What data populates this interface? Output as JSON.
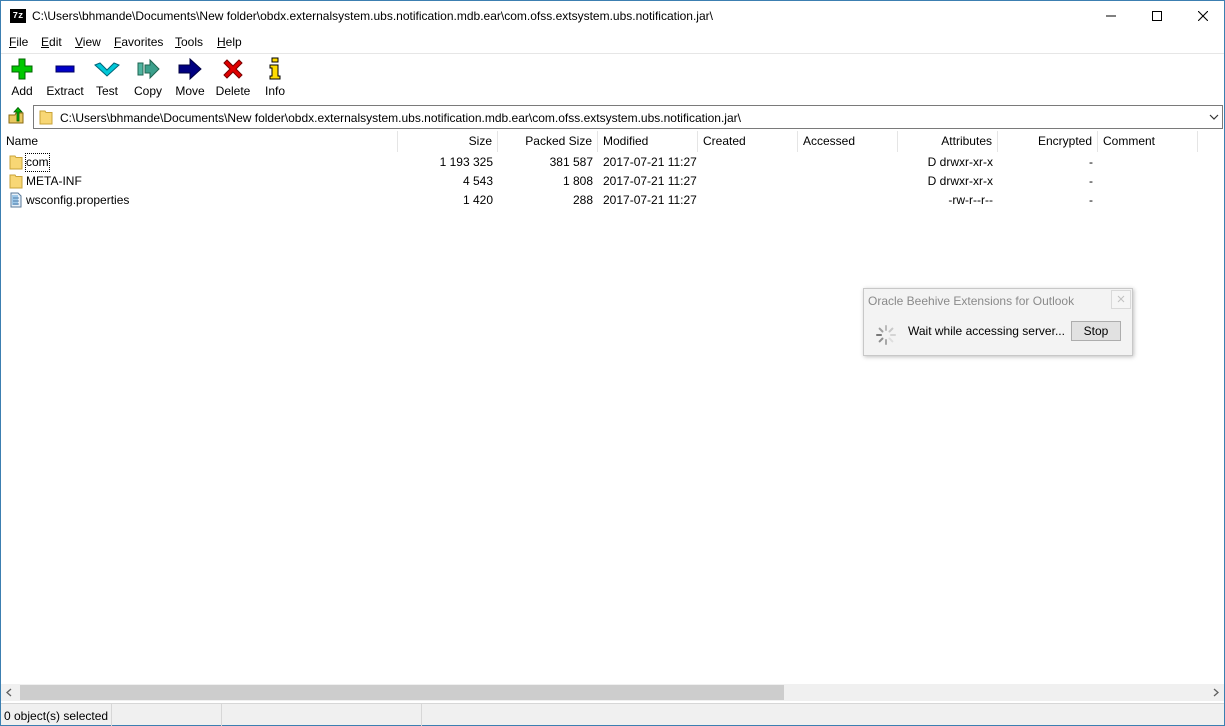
{
  "window": {
    "title": "C:\\Users\\bhmande\\Documents\\New folder\\obdx.externalsystem.ubs.notification.mdb.ear\\com.ofss.extsystem.ubs.notification.jar\\",
    "app_icon_text": "7z"
  },
  "menu": {
    "items": [
      {
        "key": "F",
        "rest": "ile"
      },
      {
        "key": "E",
        "rest": "dit"
      },
      {
        "key": "V",
        "rest": "iew"
      },
      {
        "key": "F",
        "rest": "avorites"
      },
      {
        "key": "T",
        "rest": "ools"
      },
      {
        "key": "H",
        "rest": "elp"
      }
    ]
  },
  "toolbar": {
    "add": "Add",
    "extract": "Extract",
    "test": "Test",
    "copy": "Copy",
    "move": "Move",
    "delete": "Delete",
    "info": "Info"
  },
  "address": {
    "path": "C:\\Users\\bhmande\\Documents\\New folder\\obdx.externalsystem.ubs.notification.mdb.ear\\com.ofss.extsystem.ubs.notification.jar\\"
  },
  "columns": {
    "name": "Name",
    "size": "Size",
    "packed_size": "Packed Size",
    "modified": "Modified",
    "created": "Created",
    "accessed": "Accessed",
    "attributes": "Attributes",
    "encrypted": "Encrypted",
    "comment": "Comment"
  },
  "files": [
    {
      "name": "com",
      "size": "1 193 325",
      "packed_size": "381 587",
      "modified": "2017-07-21 11:27",
      "created": "",
      "accessed": "",
      "attributes": "D drwxr-xr-x",
      "encrypted": "-",
      "comment": "",
      "icon": "folder-icon"
    },
    {
      "name": "META-INF",
      "size": "4 543",
      "packed_size": "1 808",
      "modified": "2017-07-21 11:27",
      "created": "",
      "accessed": "",
      "attributes": "D drwxr-xr-x",
      "encrypted": "-",
      "comment": "",
      "icon": "folder-icon"
    },
    {
      "name": "wsconfig.properties",
      "size": "1 420",
      "packed_size": "288",
      "modified": "2017-07-21 11:27",
      "created": "",
      "accessed": "",
      "attributes": "-rw-r--r--",
      "encrypted": "-",
      "comment": "",
      "icon": "file-icon"
    }
  ],
  "status": {
    "selection": "0 object(s) selected"
  },
  "popup": {
    "title": "Oracle Beehive Extensions for Outlook",
    "message": "Wait while accessing server...",
    "stop": "Stop"
  },
  "colors": {
    "window_border": "#3c7fb1",
    "folder": "#f8d775",
    "add_green": "#00c800",
    "extract_blue": "#0000c8",
    "test_cyan": "#00b4c8",
    "move_navy": "#000080",
    "delete_red": "#e00000"
  }
}
